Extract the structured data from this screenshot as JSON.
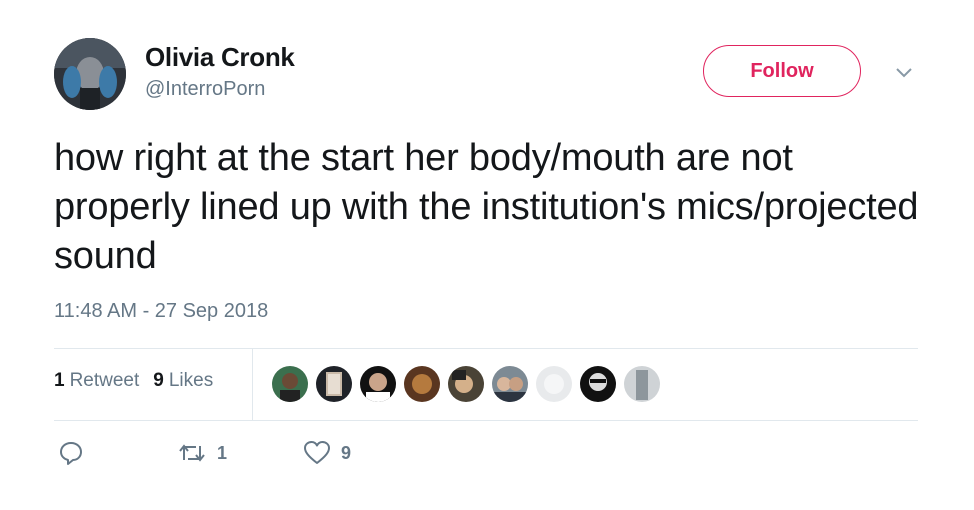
{
  "author": {
    "name": "Olivia Cronk",
    "handle": "@InterroPorn"
  },
  "follow_label": "Follow",
  "tweet_text": "how right at the start her body/mouth are not properly lined up with the institution's mics/projected sound",
  "timestamp": "11:48 AM - 27 Sep 2018",
  "stats": {
    "retweets_count": "1",
    "retweets_label": "Retweet",
    "likes_count": "9",
    "likes_label": "Likes"
  },
  "likers": [
    {
      "icon": "liker-avatar-1"
    },
    {
      "icon": "liker-avatar-2"
    },
    {
      "icon": "liker-avatar-3"
    },
    {
      "icon": "liker-avatar-4"
    },
    {
      "icon": "liker-avatar-5"
    },
    {
      "icon": "liker-avatar-6"
    },
    {
      "icon": "liker-avatar-7"
    },
    {
      "icon": "liker-avatar-8"
    },
    {
      "icon": "liker-avatar-9"
    }
  ],
  "actions": {
    "reply_icon": "reply-icon",
    "retweet_icon": "retweet-icon",
    "retweet_count": "1",
    "like_icon": "heart-icon",
    "like_count": "9"
  },
  "colors": {
    "accent": "#e0245e",
    "secondary_text": "#657786",
    "primary_text": "#14171a",
    "divider": "#e1e8ed"
  }
}
